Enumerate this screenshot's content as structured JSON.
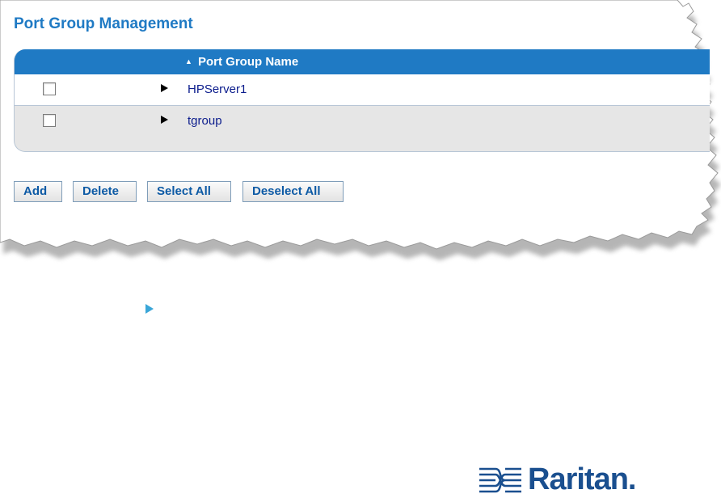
{
  "page": {
    "title": "Port Group Management"
  },
  "grid": {
    "sort_indicator": "▲",
    "column_header": "Port Group Name",
    "rows": [
      {
        "name": "HPServer1",
        "checked": false
      },
      {
        "name": "tgroup",
        "checked": false
      }
    ]
  },
  "buttons": {
    "add": "Add",
    "delete": "Delete",
    "select_all": "Select All",
    "deselect_all": "Deselect All"
  },
  "logo": {
    "text": "Raritan."
  },
  "colors": {
    "accent": "#1f7ac4",
    "link": "#0b1c8c",
    "row_alt": "#e6e6e6",
    "bullet": "#3aa6d8",
    "brand": "#1a4f8f"
  }
}
